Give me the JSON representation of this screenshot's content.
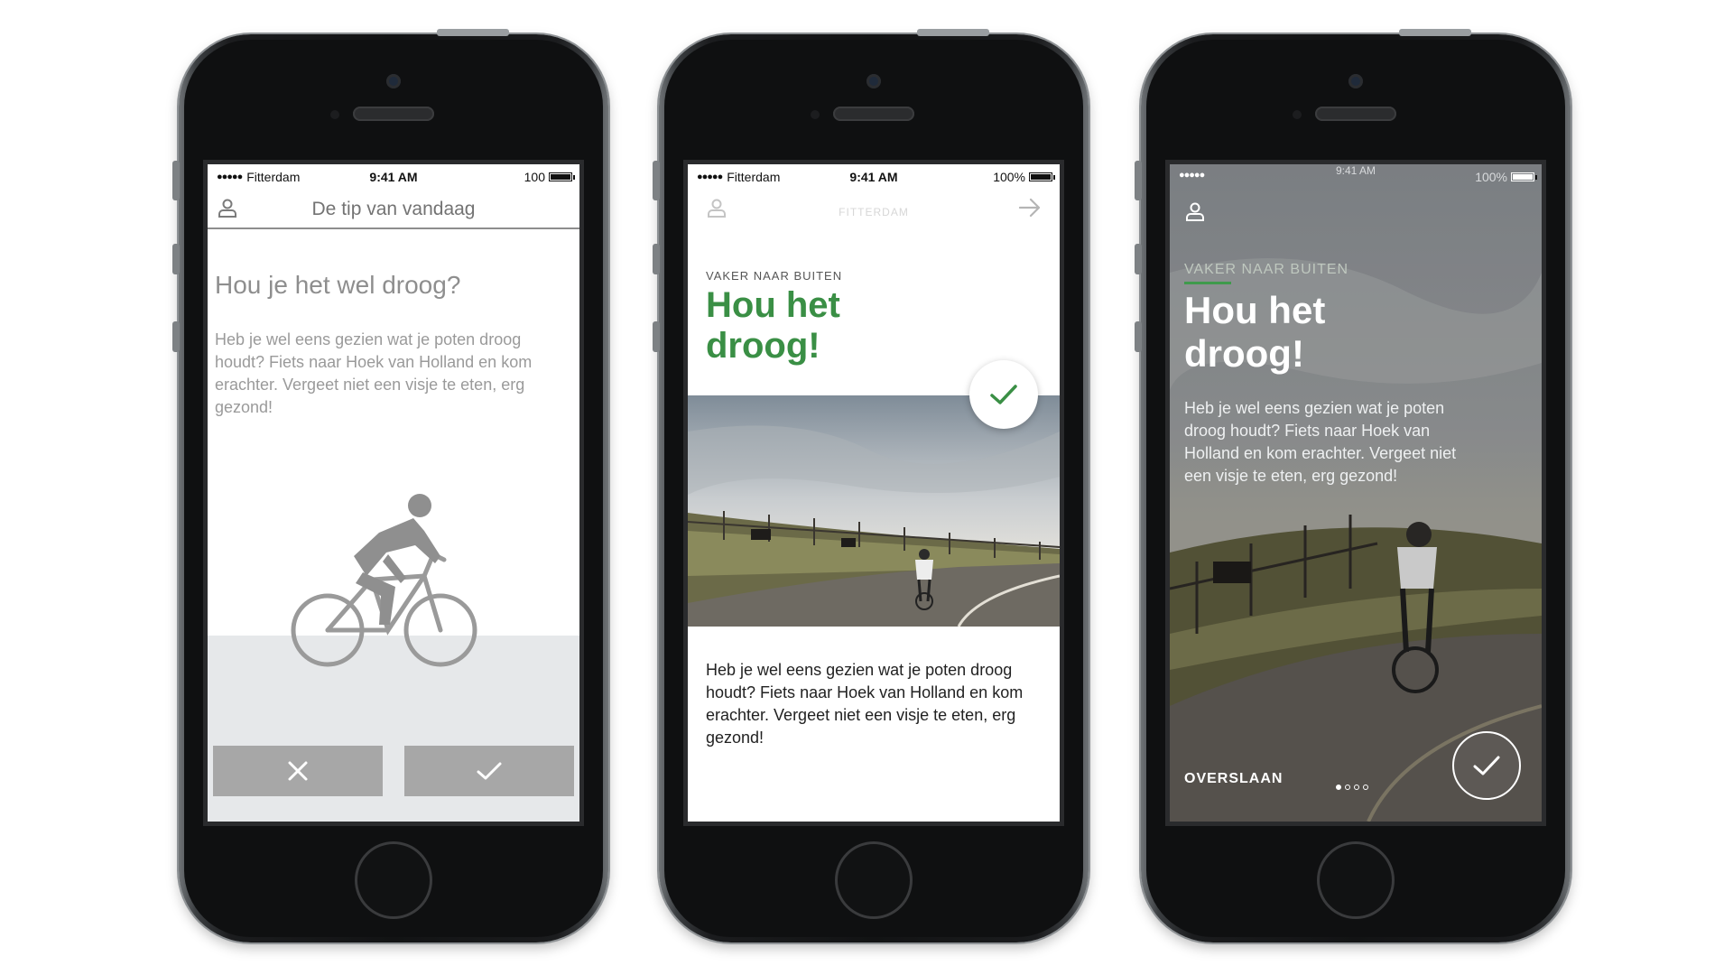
{
  "phone1": {
    "status": {
      "carrier": "Fitterdam",
      "time": "9:41 AM",
      "battery": "100",
      "battery_level": 1.0
    },
    "header_title": "De tip van vandaag",
    "heading": "Hou je het wel droog?",
    "body": "Heb je wel eens gezien wat je poten droog houdt? Fiets naar Hoek van Holland en kom erachter. Vergeet niet een visje te eten, erg gezond!",
    "icons": {
      "profile": "user-icon",
      "reject": "close-icon",
      "accept": "check-icon",
      "illustration": "cyclist-icon"
    }
  },
  "phone2": {
    "status": {
      "carrier": "Fitterdam",
      "time": "9:41 AM",
      "battery": "100%",
      "battery_level": 1.0
    },
    "brand": "FITTERDAM",
    "kicker": "VAKER NAAR BUITEN",
    "heading": "Hou het droog!",
    "body": "Heb je wel eens gezien wat je poten droog houdt? Fiets naar Hoek van Holland en kom erachter. Vergeet niet een visje te eten, erg gezond!",
    "icons": {
      "profile": "user-icon",
      "next": "arrow-right-icon",
      "accept": "check-icon"
    }
  },
  "phone3": {
    "status": {
      "time": "9:41 AM",
      "battery": "100%",
      "battery_level": 1.0
    },
    "kicker": "VAKER NAAR BUITEN",
    "heading": "Hou het droog!",
    "body": "Heb je wel eens gezien wat je poten droog houdt? Fiets naar Hoek van Holland en kom erachter. Vergeet niet een visje te eten, erg gezond!",
    "skip_label": "OVERSLAAN",
    "pager": {
      "count": 4,
      "active": 1
    },
    "icons": {
      "profile": "user-icon",
      "accept": "check-icon"
    }
  },
  "colors": {
    "accent_green": "#3a8f45",
    "button_gray": "#a7a7a7",
    "ground_gray": "#e6e8ea"
  }
}
